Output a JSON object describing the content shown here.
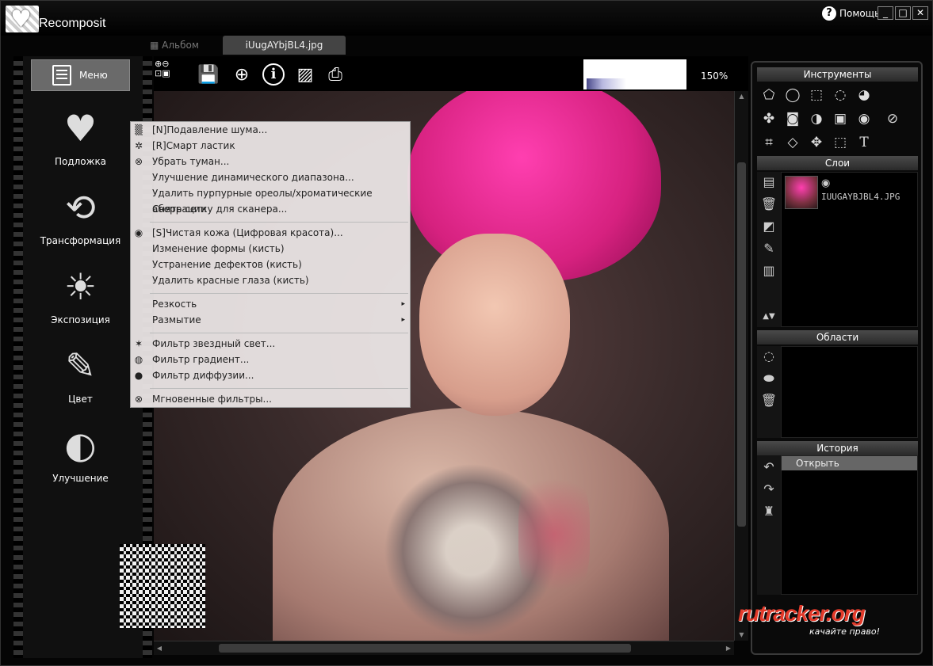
{
  "app": {
    "name": "Recomposit",
    "help_label": "Помощь",
    "window_buttons": [
      "_",
      "□",
      "✕"
    ]
  },
  "tabs": [
    {
      "label": "Альбом",
      "active": false
    },
    {
      "label": "iUugAYbjBL4.jpg",
      "active": true
    }
  ],
  "left_panel": {
    "menu_label": "Меню",
    "categories": [
      {
        "label": "Подложка",
        "icon": "heart-icon"
      },
      {
        "label": "Трансформация",
        "icon": "transform-icon"
      },
      {
        "label": "Экспозиция",
        "icon": "sun-cloud-icon"
      },
      {
        "label": "Цвет",
        "icon": "palette-brush-icon"
      },
      {
        "label": "Улучшение",
        "icon": "compact-mirror-icon"
      }
    ]
  },
  "toolbar": {
    "zoom_level": "150%",
    "icons": [
      "zoom-icons",
      "save-icon",
      "add-icon",
      "info-icon",
      "image-export-icon",
      "print-icon"
    ]
  },
  "context_menu": {
    "items": [
      {
        "label": "[N]Подавление шума...",
        "icon": "noise-icon"
      },
      {
        "label": "[R]Смарт ластик",
        "icon": "eraser-icon"
      },
      {
        "label": "Убрать туман...",
        "icon": "fog-icon"
      },
      {
        "label": "Улучшение динамического диапазона...",
        "icon": ""
      },
      {
        "label": "Удалить пурпурные ореолы/хроматические аберрации",
        "icon": ""
      },
      {
        "label": "Снять сетку для сканера...",
        "icon": ""
      },
      {
        "label": "[S]Чистая кожа (Цифровая красота)...",
        "icon": "eye-icon"
      },
      {
        "label": "Изменение формы (кисть)",
        "icon": ""
      },
      {
        "label": "Устранение дефектов (кисть)",
        "icon": ""
      },
      {
        "label": "Удалить красные глаза (кисть)",
        "icon": ""
      },
      {
        "label": "Резкость",
        "icon": "",
        "submenu": true
      },
      {
        "label": "Размытие",
        "icon": "",
        "submenu": true
      },
      {
        "label": "Фильтр звездный свет...",
        "icon": "star-icon"
      },
      {
        "label": "Фильтр градиент...",
        "icon": "gradient-icon"
      },
      {
        "label": "Фильтр диффузии...",
        "icon": "diffusion-icon"
      },
      {
        "label": "Мгновенные фильтры...",
        "icon": "instant-filter-icon"
      }
    ]
  },
  "right_panel": {
    "tools_title": "Инструменты",
    "layers_title": "Слои",
    "layer_name": "IUUGAYBJBL4.JPG",
    "areas_title": "Области",
    "history_title": "История",
    "history_items": [
      "Открыть"
    ]
  },
  "branding": {
    "logo_text": "rutracker.org",
    "slogan": "качайте право!"
  }
}
